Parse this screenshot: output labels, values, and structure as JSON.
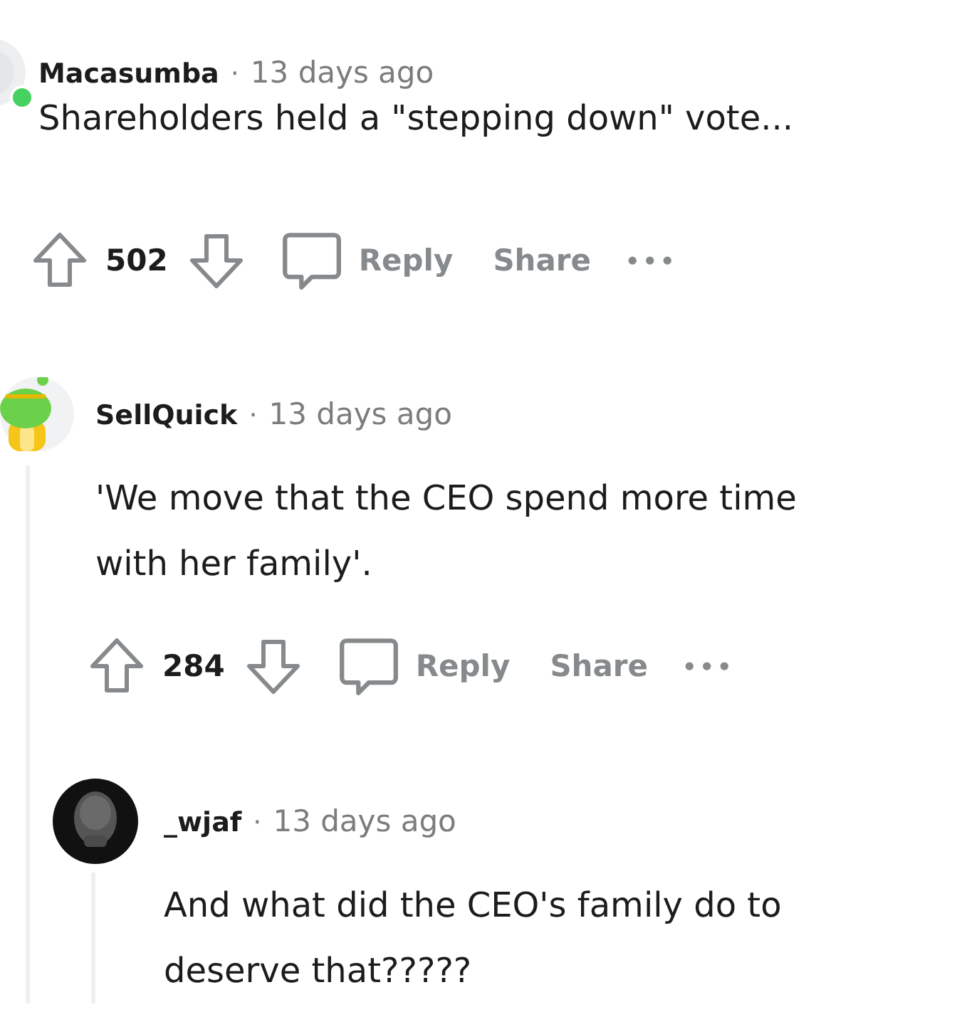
{
  "comments": [
    {
      "username": "Macasumba",
      "separator": "·",
      "time": "13 days ago",
      "online": true,
      "thread_line": false,
      "body": [
        "Shareholders held a \"stepping down\" vote..."
      ],
      "votes": "502",
      "actions": [
        "Reply",
        "Share"
      ],
      "more": "•••",
      "children": [
        {
          "username": "SellQuick",
          "separator": "·",
          "time": "13 days ago",
          "online": false,
          "thread_line": true,
          "body": [
            "'We move that the CEO spend more time",
            "with her family'."
          ],
          "votes": "284",
          "actions": [
            "Reply",
            "Share"
          ],
          "more": "•••",
          "children": [
            {
              "username": "_wjaf",
              "separator": "·",
              "time": "13 days ago",
              "online": false,
              "thread_line": true,
              "body": [
                "And what did the CEO's family do to",
                "deserve that?????"
              ]
            }
          ]
        }
      ]
    }
  ]
}
